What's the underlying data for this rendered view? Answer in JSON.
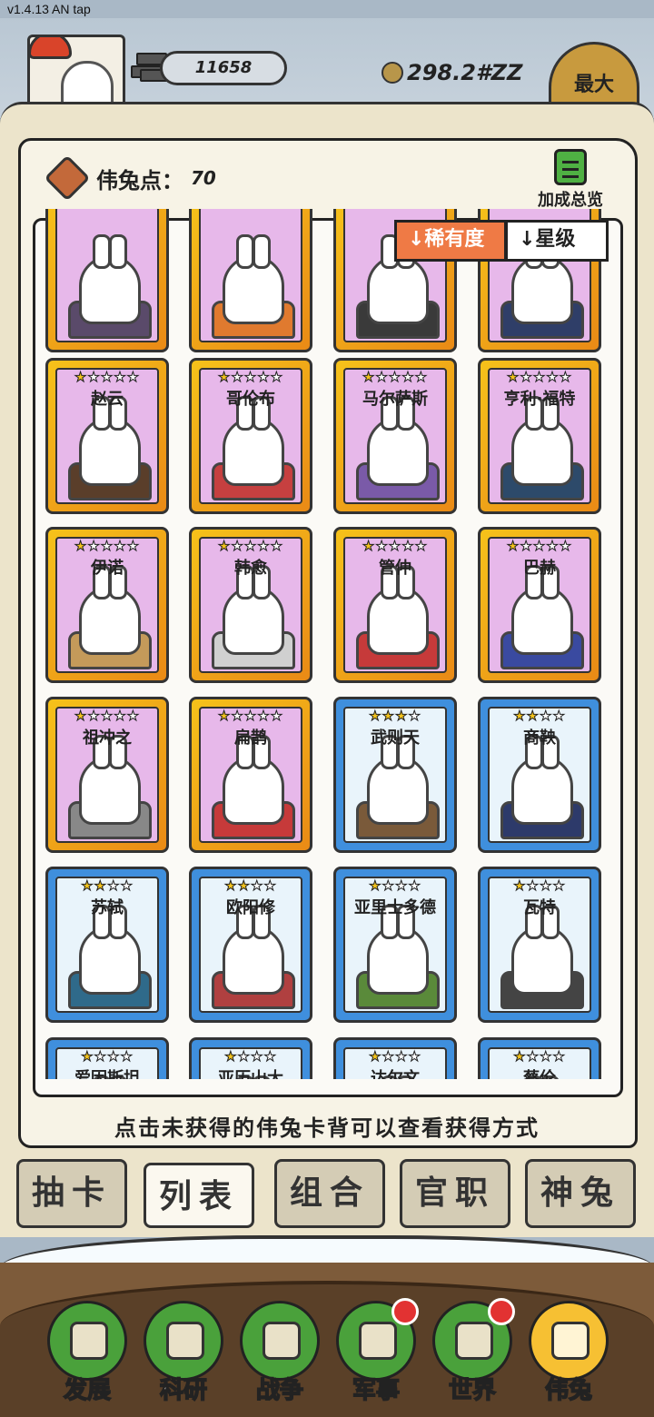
{
  "version": "v1.4.13 AN tap",
  "top": {
    "gold_bars": "11658",
    "coins": "298.2#ZZ",
    "max_label": "最大"
  },
  "points": {
    "label": "伟兔点：",
    "value": "70"
  },
  "bonus_label": "加成总览",
  "sort": {
    "rarity": "↓稀有度",
    "star": "↓星级"
  },
  "cards": [
    {
      "name": "",
      "rarity": "gold",
      "stars": 0
    },
    {
      "name": "",
      "rarity": "gold",
      "stars": 0
    },
    {
      "name": "",
      "rarity": "gold",
      "stars": 0
    },
    {
      "name": "",
      "rarity": "gold",
      "stars": 0
    },
    {
      "name": "赵云",
      "rarity": "gold",
      "stars": 1
    },
    {
      "name": "哥伦布",
      "rarity": "gold",
      "stars": 1
    },
    {
      "name": "马尔萨斯",
      "rarity": "gold",
      "stars": 1
    },
    {
      "name": "亨利·福特",
      "rarity": "gold",
      "stars": 1
    },
    {
      "name": "伊诺",
      "rarity": "gold",
      "stars": 1
    },
    {
      "name": "韩愈",
      "rarity": "gold",
      "stars": 1
    },
    {
      "name": "管仲",
      "rarity": "gold",
      "stars": 1
    },
    {
      "name": "巴赫",
      "rarity": "gold",
      "stars": 1
    },
    {
      "name": "祖冲之",
      "rarity": "gold",
      "stars": 1
    },
    {
      "name": "扁鹊",
      "rarity": "gold",
      "stars": 1
    },
    {
      "name": "武则天",
      "rarity": "blue",
      "stars": 3
    },
    {
      "name": "商鞅",
      "rarity": "blue",
      "stars": 2
    },
    {
      "name": "苏轼",
      "rarity": "blue",
      "stars": 2
    },
    {
      "name": "欧阳修",
      "rarity": "blue",
      "stars": 2
    },
    {
      "name": "亚里士多德",
      "rarity": "blue",
      "stars": 1
    },
    {
      "name": "瓦特",
      "rarity": "blue",
      "stars": 1
    },
    {
      "name": "爱因斯坦",
      "rarity": "blue",
      "stars": 1
    },
    {
      "name": "亚历山大",
      "rarity": "blue",
      "stars": 1
    },
    {
      "name": "达尔文",
      "rarity": "blue",
      "stars": 1
    },
    {
      "name": "蔡伦",
      "rarity": "blue",
      "stars": 1
    }
  ],
  "hint": "点击未获得的伟兔卡背可以查看获得方式",
  "tabs": [
    "抽卡",
    "列表",
    "组合",
    "官职",
    "神兔"
  ],
  "active_tab": "列表",
  "nav": [
    {
      "label": "发展",
      "icon": "growth-icon",
      "badge": false
    },
    {
      "label": "科研",
      "icon": "flask-icon",
      "badge": false
    },
    {
      "label": "战争",
      "icon": "swords-icon",
      "badge": false
    },
    {
      "label": "军事",
      "icon": "helmet-icon",
      "badge": true
    },
    {
      "label": "世界",
      "icon": "globe-icon",
      "badge": true
    },
    {
      "label": "伟兔",
      "icon": "rabbit-portrait-icon",
      "badge": false
    }
  ],
  "active_nav": "伟兔",
  "colors": {
    "gold_card": "#f6c21a",
    "blue_card": "#3f8fdd",
    "purple_face": "#e7b8ea",
    "nav_green": "#4aa13b",
    "nav_active": "#f6c033",
    "sort_orange": "#ef7a45"
  }
}
